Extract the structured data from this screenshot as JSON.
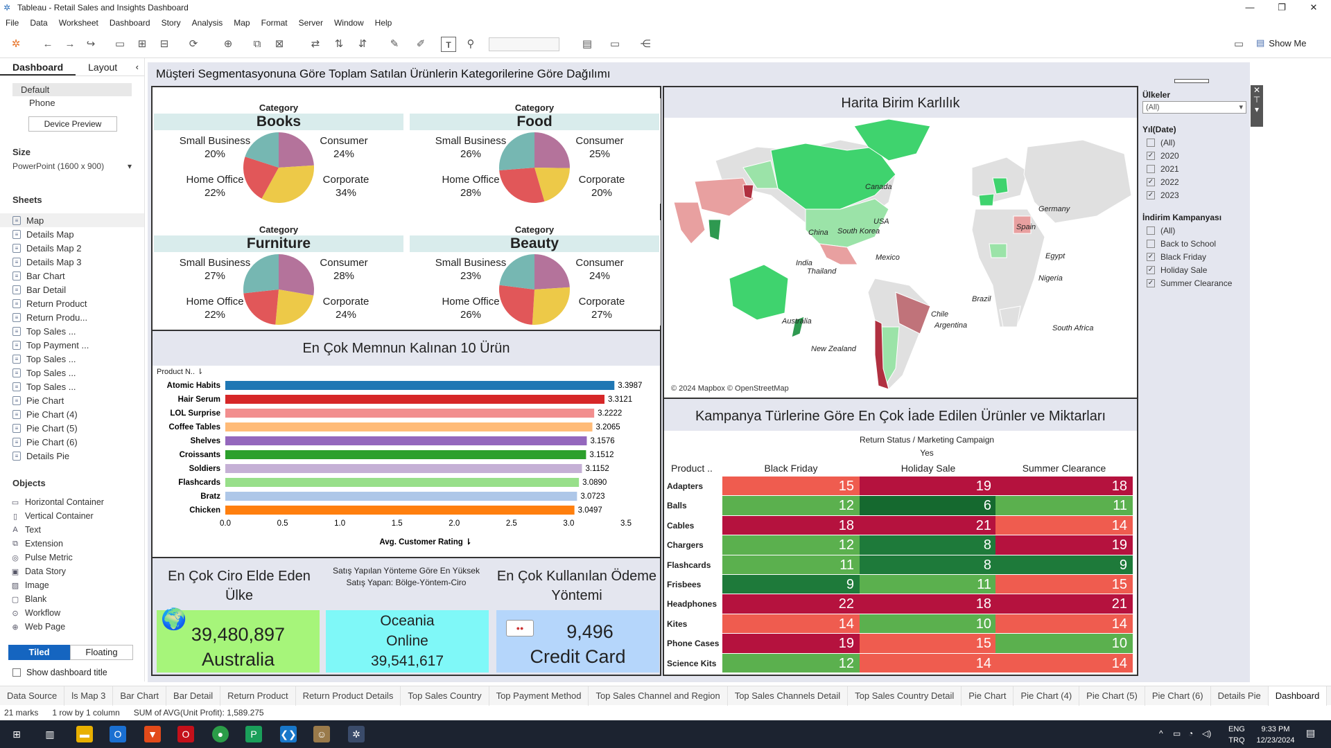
{
  "window": {
    "title": "Tableau - Retail Sales and Insights Dashboard"
  },
  "menu": [
    "File",
    "Data",
    "Worksheet",
    "Dashboard",
    "Story",
    "Analysis",
    "Map",
    "Format",
    "Server",
    "Window",
    "Help"
  ],
  "toolbar": {
    "show_me": "Show Me"
  },
  "left_panel": {
    "tabs": [
      "Dashboard",
      "Layout"
    ],
    "devices": [
      "Default",
      "Phone"
    ],
    "device_preview": "Device Preview",
    "size_heading": "Size",
    "size_value": "PowerPoint (1600 x 900)",
    "sheets_heading": "Sheets",
    "sheets": [
      "Map",
      "Details Map",
      "Details Map 2",
      "Details Map 3",
      "Bar Chart",
      "Bar Detail",
      "Return Product",
      "Return Produ...",
      "Top Sales ...",
      "Top Payment ...",
      "Top Sales ...",
      "Top Sales ...",
      "Top Sales ...",
      "Pie Chart",
      "Pie Chart (4)",
      "Pie Chart (5)",
      "Pie Chart (6)",
      "Details Pie"
    ],
    "objects_heading": "Objects",
    "objects": [
      "Horizontal Container",
      "Vertical Container",
      "Text",
      "Extension",
      "Pulse Metric",
      "Data Story",
      "Image",
      "Blank",
      "Workflow",
      "Web Page"
    ],
    "tiled": "Tiled",
    "floating": "Floating",
    "show_title": "Show dashboard title"
  },
  "dashboard": {
    "title": "Müşteri Segmentasyonuna Göre Toplam Satılan Ürünlerin Kategorilerine Göre Dağılımı",
    "pies": [
      {
        "category_label": "Category",
        "category": "Books",
        "segments": [
          {
            "name": "Consumer",
            "pct": "24%"
          },
          {
            "name": "Corporate",
            "pct": "34%"
          },
          {
            "name": "Home Office",
            "pct": "22%"
          },
          {
            "name": "Small Business",
            "pct": "20%"
          }
        ]
      },
      {
        "category_label": "Category",
        "category": "Food",
        "segments": [
          {
            "name": "Consumer",
            "pct": "25%"
          },
          {
            "name": "Corporate",
            "pct": "20%"
          },
          {
            "name": "Home Office",
            "pct": "28%"
          },
          {
            "name": "Small Business",
            "pct": "26%"
          }
        ]
      },
      {
        "category_label": "Category",
        "category": "Furniture",
        "segments": [
          {
            "name": "Consumer",
            "pct": "28%"
          },
          {
            "name": "Corporate",
            "pct": "24%"
          },
          {
            "name": "Home Office",
            "pct": "22%"
          },
          {
            "name": "Small Business",
            "pct": "27%"
          }
        ]
      },
      {
        "category_label": "Category",
        "category": "Beauty",
        "segments": [
          {
            "name": "Consumer",
            "pct": "24%"
          },
          {
            "name": "Corporate",
            "pct": "27%"
          },
          {
            "name": "Home Office",
            "pct": "26%"
          },
          {
            "name": "Small Business",
            "pct": "23%"
          }
        ]
      }
    ],
    "segment_colors": {
      "Consumer": "#b4739b",
      "Corporate": "#edc948",
      "Home Office": "#e15759",
      "Small Business": "#76b7b2"
    },
    "map": {
      "title": "Harita Birim Karlılık",
      "credit": "© 2024 Mapbox © OpenStreetMap",
      "labels": [
        "Canada",
        "USA",
        "Mexico",
        "China",
        "South Korea",
        "India",
        "Thailand",
        "Australia",
        "New Zealand",
        "Germany",
        "Spain",
        "Egypt",
        "Nigeria",
        "Brazil",
        "Chile",
        "Argentina",
        "South Africa"
      ]
    },
    "bar_chart": {
      "title": "En Çok Memnun Kalınan 10 Ürün",
      "y_header": "Product N..",
      "x_label": "Avg. Customer Rating",
      "ticks": [
        "0.0",
        "0.5",
        "1.0",
        "1.5",
        "2.0",
        "2.5",
        "3.0",
        "3.5"
      ]
    },
    "heatmap": {
      "title": "Kampanya Türlerine Göre En Çok İade Edilen Ürünler ve Miktarları",
      "header_top": "Return Status  /  Marketing Campaign",
      "header_yes": "Yes",
      "row_header": "Product ..",
      "columns": [
        "Black Friday",
        "Holiday Sale",
        "Summer Clearance"
      ],
      "rows": [
        "Adapters",
        "Balls",
        "Cables",
        "Chargers",
        "Flashcards",
        "Frisbees",
        "Headphones",
        "Kites",
        "Phone Cases",
        "Science Kits"
      ],
      "values": [
        [
          15,
          19,
          18
        ],
        [
          12,
          6,
          11
        ],
        [
          18,
          21,
          14
        ],
        [
          12,
          8,
          19
        ],
        [
          11,
          8,
          9
        ],
        [
          9,
          11,
          15
        ],
        [
          22,
          18,
          21
        ],
        [
          14,
          10,
          14
        ],
        [
          19,
          15,
          10
        ],
        [
          12,
          14,
          14
        ]
      ]
    },
    "kpis": {
      "country_title": "En Çok Ciro Elde Eden Ülke",
      "country_value": "39,480,897",
      "country_name": "Australia",
      "channel_title": "Satış Yapılan Yönteme Göre En Yüksek Satış Yapan: Bölge-Yöntem-Ciro",
      "channel_region": "Oceania",
      "channel_method": "Online",
      "channel_value": "39,541,617",
      "payment_title": "En Çok Kullanılan Ödeme Yöntemi",
      "payment_value": "9,496",
      "payment_method": "Credit Card"
    },
    "filters": {
      "countries_title": "Ülkeler",
      "countries_value": "(All)",
      "year_title": "Yıl(Date)",
      "years": [
        {
          "label": "(All)",
          "checked": false
        },
        {
          "label": "2020",
          "checked": true
        },
        {
          "label": "2021",
          "checked": false
        },
        {
          "label": "2022",
          "checked": true
        },
        {
          "label": "2023",
          "checked": true
        }
      ],
      "campaign_title": "İndirim Kampanyası",
      "campaigns": [
        {
          "label": "(All)",
          "checked": false
        },
        {
          "label": "Back to School",
          "checked": false
        },
        {
          "label": "Black Friday",
          "checked": true
        },
        {
          "label": "Holiday Sale",
          "checked": true
        },
        {
          "label": "Summer Clearance",
          "checked": true
        }
      ]
    }
  },
  "chart_data": {
    "type": "bar",
    "categories": [
      "Atomic Habits",
      "Hair Serum",
      "LOL Surprise",
      "Coffee Tables",
      "Shelves",
      "Croissants",
      "Soldiers",
      "Flashcards",
      "Bratz",
      "Chicken"
    ],
    "values": [
      3.3987,
      3.3121,
      3.2222,
      3.2065,
      3.1576,
      3.1512,
      3.1152,
      3.089,
      3.0723,
      3.0497
    ],
    "value_labels": [
      "3.3987",
      "3.3121",
      "3.2222",
      "3.2065",
      "3.1576",
      "3.1512",
      "3.1152",
      "3.0890",
      "3.0723",
      "3.0497"
    ],
    "colors": [
      "#1f77b4",
      "#d62728",
      "#f28e8e",
      "#ffbb78",
      "#9467bd",
      "#2ca02c",
      "#c5b0d5",
      "#98df8a",
      "#aec7e8",
      "#ff7f0e"
    ],
    "title": "En Çok Memnun Kalınan 10 Ürün",
    "xlabel": "Avg. Customer Rating",
    "ylabel": "Product N..",
    "xlim": [
      0,
      3.5
    ]
  },
  "bottom_tabs": [
    "Data Source",
    "ls Map 3",
    "Bar Chart",
    "Bar Detail",
    "Return Product",
    "Return Product Details",
    "Top Sales Country",
    "Top Payment Method",
    "Top Sales Channel and Region",
    "Top Sales Channels Detail",
    "Top Sales Country Detail",
    "Pie Chart",
    "Pie Chart (4)",
    "Pie Chart (5)",
    "Pie Chart (6)",
    "Details Pie",
    "Dashboard"
  ],
  "status": {
    "marks": "21 marks",
    "rows": "1 row by 1 column",
    "sum": "SUM of AVG(Unit Profit): 1,589.275"
  },
  "taskbar": {
    "lang": "ENG",
    "region": "TRQ",
    "time": "9:33 PM",
    "date": "12/23/2024"
  }
}
